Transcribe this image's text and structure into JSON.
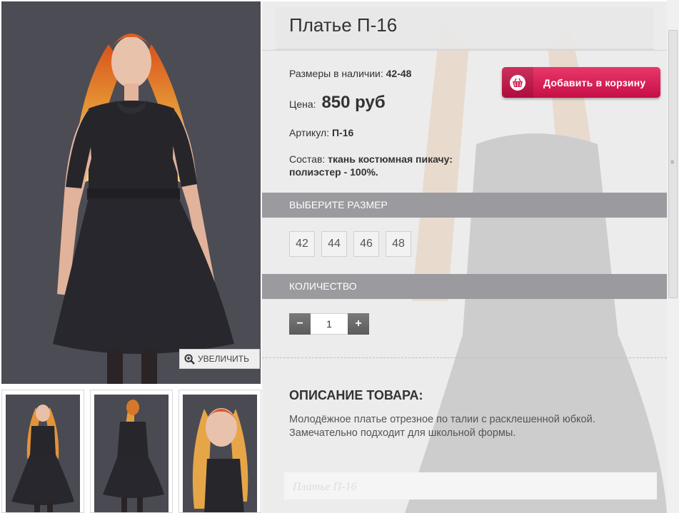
{
  "product": {
    "title": "Платье П-16",
    "sizes_label": "Размеры в наличии:",
    "sizes_value": "42-48",
    "price_label": "Цена:",
    "price_value": "850 руб",
    "article_label": "Артикул:",
    "article_value": "П-16",
    "composition_label": "Состав:",
    "composition_value_line1": "ткань костюмная пикачу:",
    "composition_value_line2": "полиэстер - 100%."
  },
  "cart_button": {
    "label": "Добавить в корзину",
    "icon": "basket-icon",
    "color": "#d61f52"
  },
  "gallery": {
    "zoom_label": "УВЕЛИЧИТЬ",
    "zoom_icon": "magnifier-plus-icon",
    "thumbnails": 3
  },
  "size_section": {
    "heading": "ВЫБЕРИТЕ РАЗМЕР",
    "options": [
      "42",
      "44",
      "46",
      "48"
    ]
  },
  "quantity_section": {
    "heading": "КОЛИЧЕСТВО",
    "value": "1",
    "minus": "−",
    "plus": "+"
  },
  "description": {
    "heading": "ОПИСАНИЕ ТОВАРА:",
    "text_line1": "Молодёжное платье отрезное по талии с расклешенной юбкой.",
    "text_line2": "Замечательно подходит для школьной формы.",
    "footer_caption": "Платье П-16"
  },
  "colors": {
    "section_bar": "#9a9a9f",
    "panel_bg": "#ececec",
    "photo_bg": "#4d4d55"
  }
}
